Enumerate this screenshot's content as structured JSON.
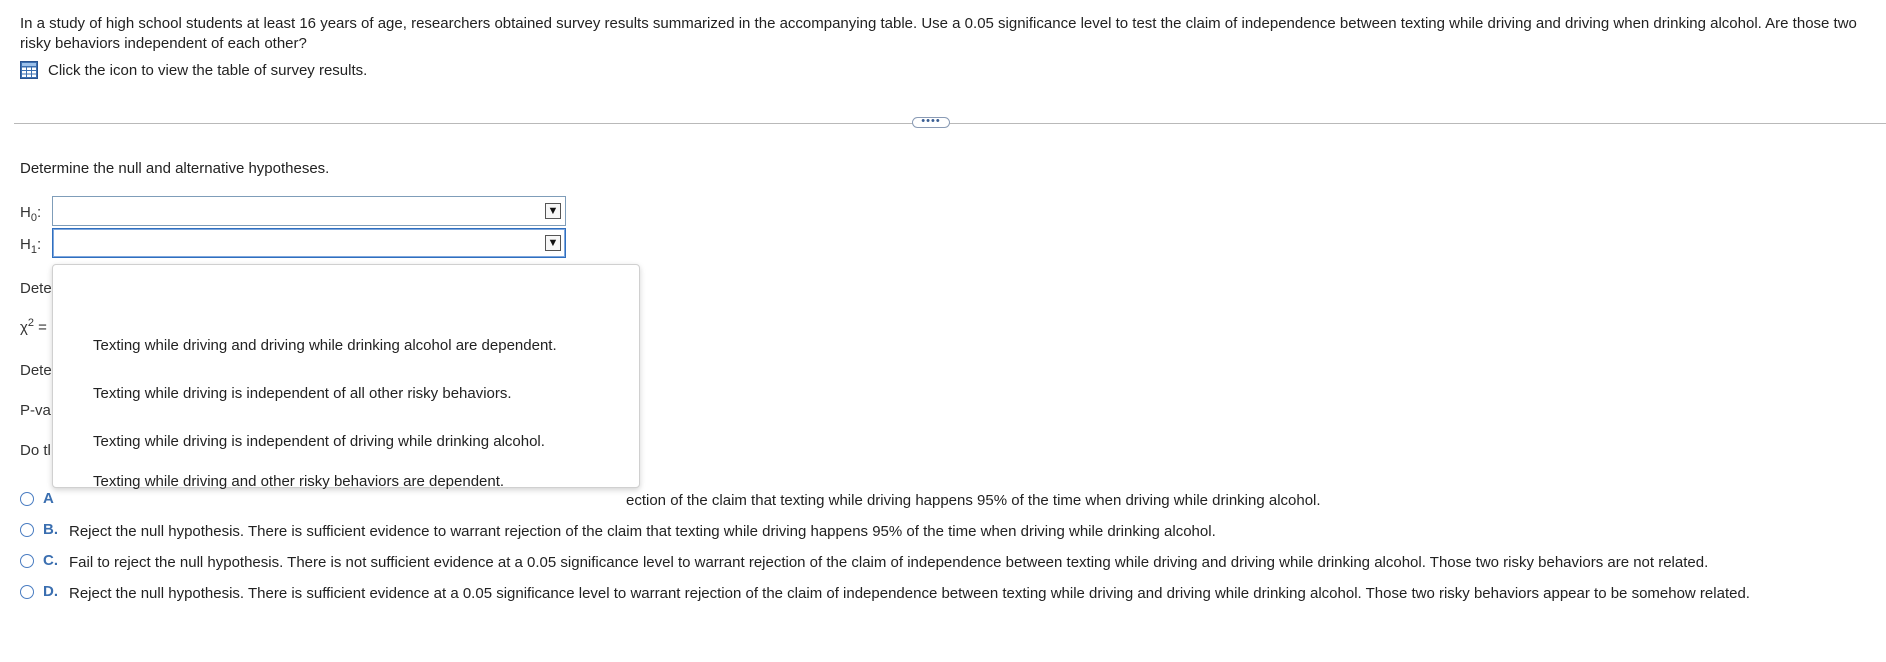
{
  "question": {
    "text": "In a study of high school students at least 16 years of age, researchers obtained survey results summarized in the accompanying table. Use a 0.05 significance level to test the claim of independence between texting while driving and driving when drinking alcohol. Are those two risky behaviors independent of each other?",
    "icon_hint": "Click the icon to view the table of survey results."
  },
  "more_button": "••••",
  "hypotheses": {
    "prompt": "Determine the null and alternative hypotheses.",
    "h0_label": "H",
    "h0_sub": "0",
    "h1_label": "H",
    "h1_sub": "1",
    "colon": ":",
    "h0_value": "",
    "h1_value": ""
  },
  "obscured": {
    "determine1": "Dete",
    "chi_prefix": "χ",
    "chi_sup": "2",
    "chi_eq": " =",
    "determine2": "Dete",
    "pvalue": "P-va",
    "do_the": "Do tl"
  },
  "dropdown_options": [
    "Texting while driving and driving while drinking alcohol are dependent.",
    "Texting while driving is independent of all other risky behaviors.",
    "Texting while driving is independent of driving while drinking alcohol.",
    "Texting while driving and other risky behaviors are dependent."
  ],
  "choices": [
    {
      "letter": "A",
      "text": "ection of the claim that texting while driving happens 95% of the time when driving while drinking alcohol."
    },
    {
      "letter": "B.",
      "text": "Reject the null hypothesis. There is sufficient evidence to warrant rejection of the claim that texting while driving happens 95% of the time when driving while drinking alcohol."
    },
    {
      "letter": "C.",
      "text": "Fail to reject the null hypothesis. There is not sufficient evidence at a 0.05 significance level to warrant rejection of the claim of independence between texting while driving and driving while drinking alcohol. Those two risky behaviors are not related."
    },
    {
      "letter": "D.",
      "text": "Reject the null hypothesis. There is sufficient evidence at a 0.05 significance level to warrant rejection of the claim of independence between texting while driving and driving while drinking alcohol. Those two risky behaviors appear to be somehow related."
    }
  ],
  "colors": {
    "accent": "#3b6fb0",
    "select_border": "#7f9db9"
  }
}
